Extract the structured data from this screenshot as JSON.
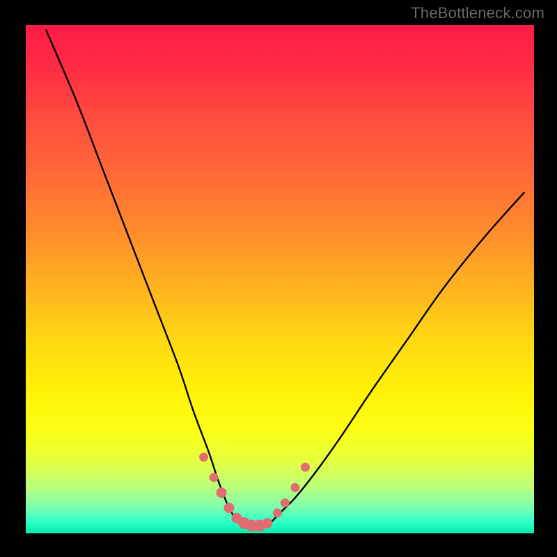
{
  "watermark_text": "TheBottleneck.com",
  "chart_data": {
    "type": "line",
    "title": "",
    "xlabel": "",
    "ylabel": "",
    "xlim": [
      0,
      100
    ],
    "ylim": [
      0,
      100
    ],
    "grid": false,
    "legend": false,
    "series": [
      {
        "name": "bottleneck-curve",
        "x": [
          4,
          10,
          15,
          20,
          25,
          30,
          33,
          36,
          38,
          40,
          42,
          44,
          46,
          48,
          50,
          53,
          57,
          62,
          68,
          75,
          82,
          90,
          98
        ],
        "values": [
          99,
          85,
          72,
          59,
          46,
          33,
          24,
          16,
          10,
          5,
          2,
          1,
          1,
          2,
          4,
          7,
          12,
          19,
          28,
          38,
          48,
          58,
          67
        ]
      }
    ],
    "markers": {
      "name": "highlighted-points",
      "x": [
        35,
        37,
        38.5,
        40,
        41.5,
        43,
        44.5,
        46,
        47.5,
        49.5,
        51,
        53,
        55
      ],
      "values": [
        15,
        11,
        8,
        5,
        3,
        2,
        1.5,
        1.5,
        2,
        4,
        6,
        9,
        13
      ],
      "sizes": [
        6,
        6,
        7,
        7,
        7,
        8,
        8,
        8,
        7,
        6,
        6,
        6,
        6
      ]
    }
  },
  "colors": {
    "curve_stroke": "#000000",
    "marker_fill": "#e06d72",
    "frame_bg": "#000000"
  }
}
